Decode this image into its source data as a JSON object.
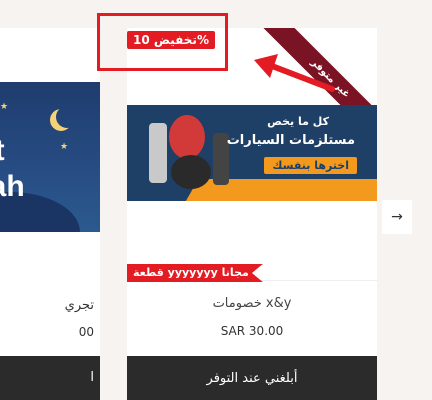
{
  "left_card": {
    "banner_line1": "st",
    "banner_line2": "rah",
    "name": "تجري",
    "price": "00",
    "button_label": "ا"
  },
  "product": {
    "ribbon": "غير متوفر",
    "discount": "تخفيض 10%",
    "banner": {
      "line1": "كل ما يخص",
      "line2": "مستلزمات السيارات",
      "cta": "اخترها بنفسك"
    },
    "free_badge": "قطعة yyyyyyy مجانا",
    "name": "خصومات x&y",
    "price": "SAR 30.00",
    "notify_label": "أبلغني عند التوفر"
  },
  "nav": {
    "next_glyph": "→"
  },
  "colors": {
    "badge_red": "#e31b23",
    "ribbon": "#7a1324",
    "button_dark": "#2b2b2b"
  }
}
